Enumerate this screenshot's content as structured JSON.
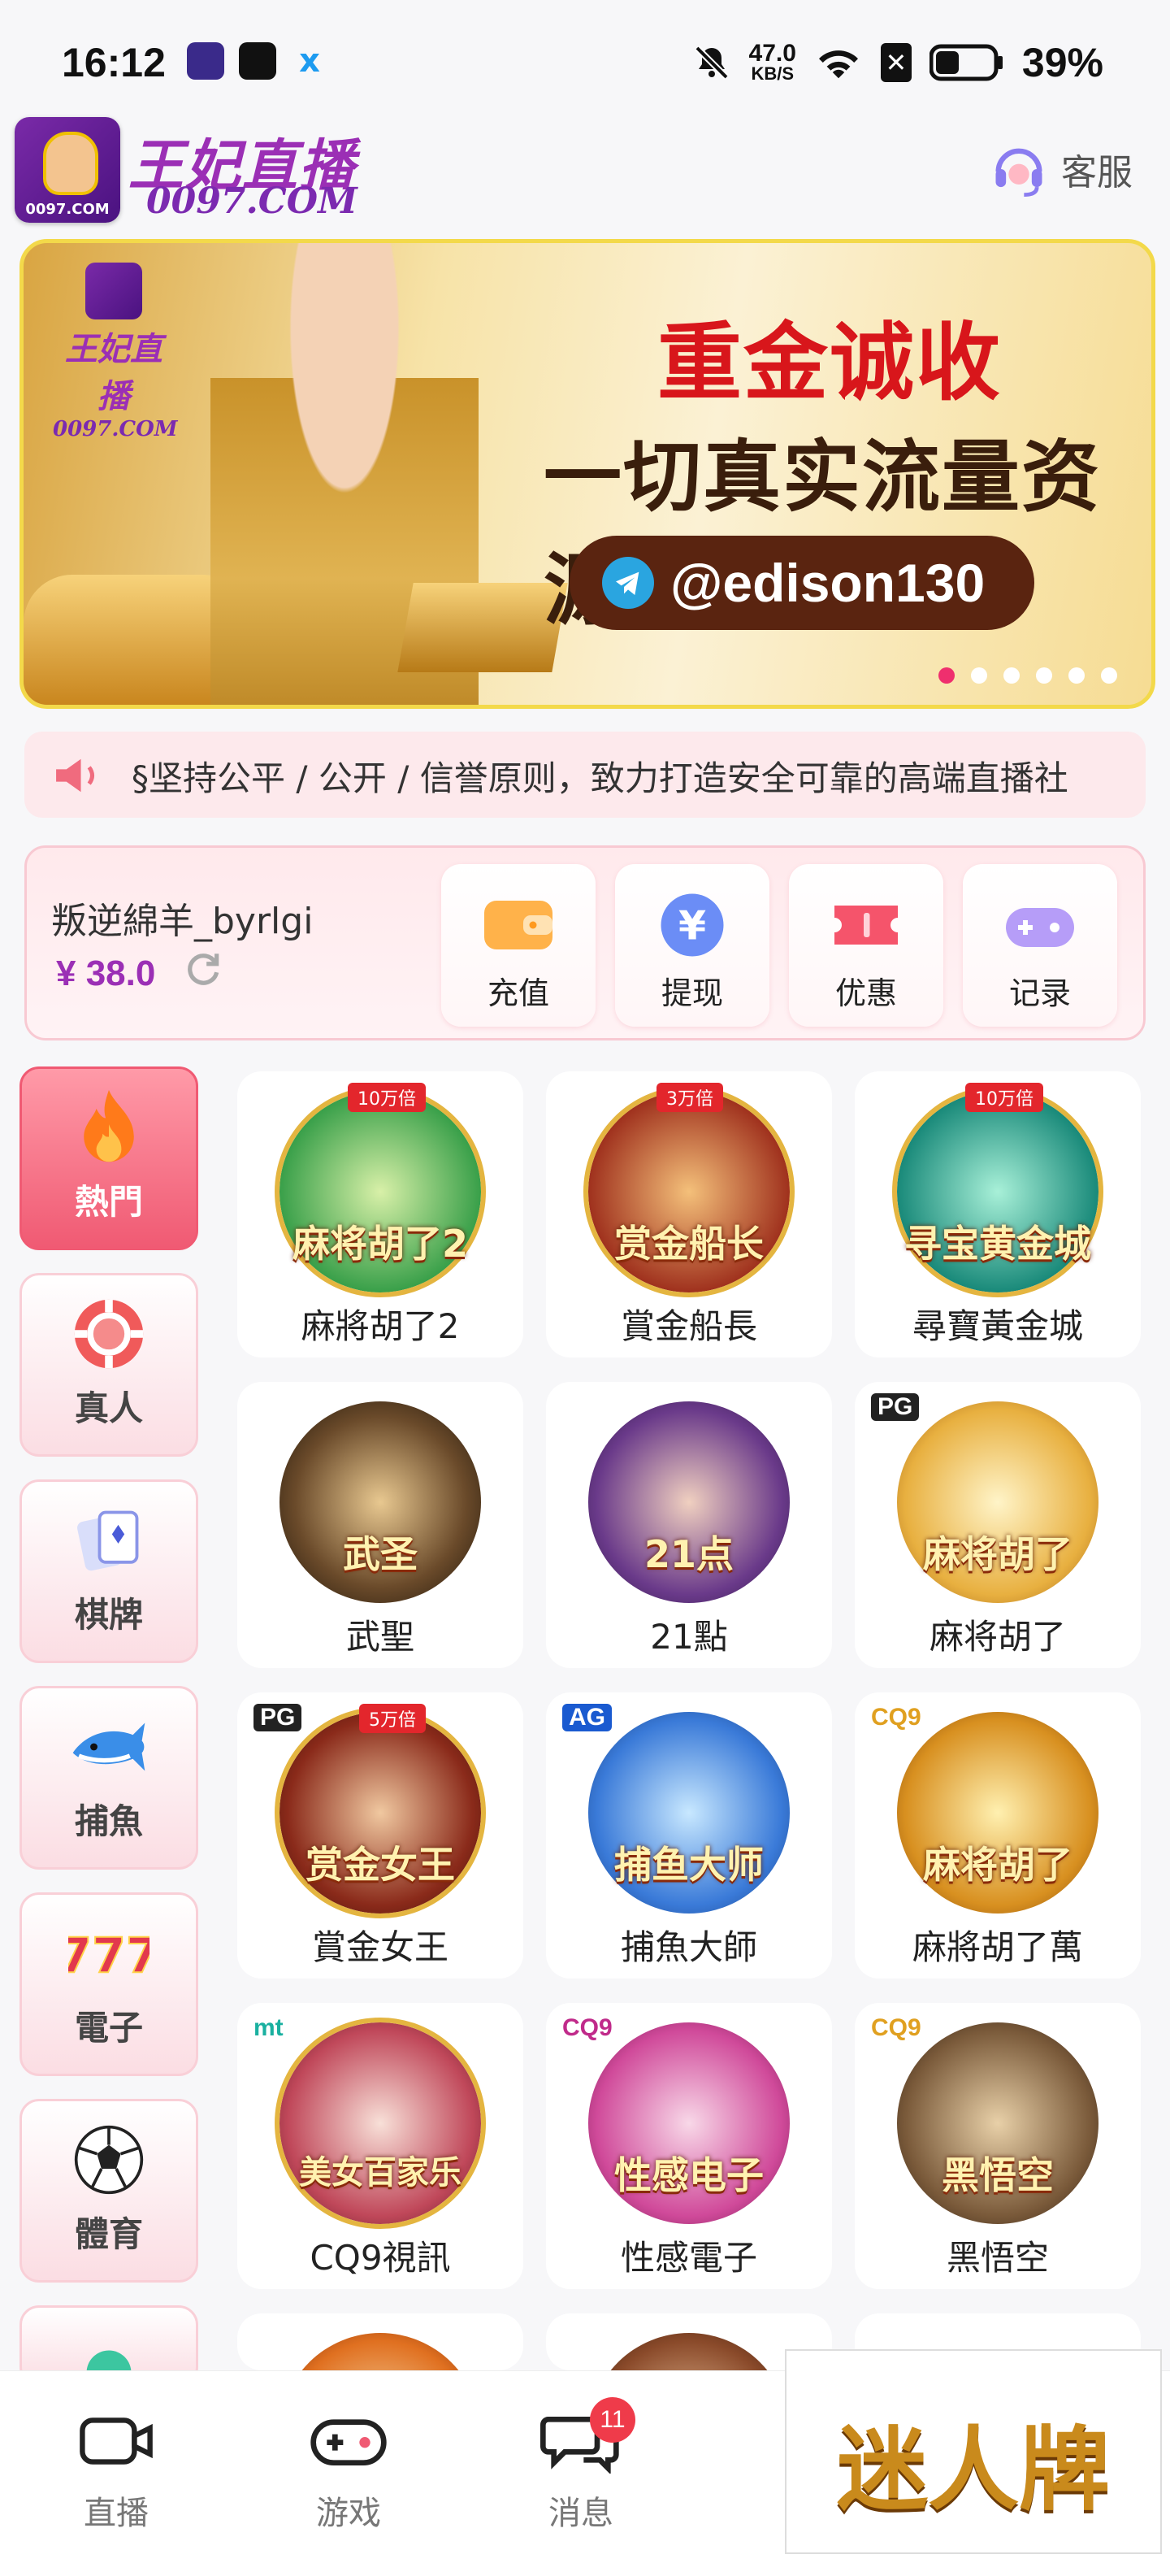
{
  "status_bar": {
    "time": "16:12",
    "speed_value": "47.0",
    "speed_unit": "KB/S",
    "battery": "39%"
  },
  "header": {
    "brand_name": "王妃直播",
    "brand_url": "0097.COM",
    "service_label": "客服"
  },
  "banner": {
    "headline": "重金诚收",
    "subheadline": "一切真实流量资源",
    "telegram_handle": "@edison130",
    "mini_logo_name": "王妃直播",
    "mini_logo_url": "0097.COM",
    "slide_count": 6,
    "active_slide": 1
  },
  "marquee": {
    "text": "§坚持公平 / 公开 / 信誉原则，致力打造安全可靠的高端直播社"
  },
  "account": {
    "username": "叛逆綿羊_byrlgi",
    "balance": "¥ 38.0",
    "actions": [
      {
        "label": "充值",
        "icon": "wallet-icon"
      },
      {
        "label": "提现",
        "icon": "yen-coin-icon"
      },
      {
        "label": "优惠",
        "icon": "ticket-icon"
      },
      {
        "label": "记录",
        "icon": "gamepad-icon"
      }
    ]
  },
  "categories": [
    {
      "label": "熱門",
      "icon": "flame-icon",
      "active": true
    },
    {
      "label": "真人",
      "icon": "poker-chip-icon"
    },
    {
      "label": "棋牌",
      "icon": "playing-cards-icon"
    },
    {
      "label": "捕魚",
      "icon": "shark-icon"
    },
    {
      "label": "電子",
      "icon": "slot-777-icon"
    },
    {
      "label": "體育",
      "icon": "soccer-ball-icon"
    }
  ],
  "games": [
    {
      "name": "麻將胡了2",
      "mult": "10万倍",
      "art": "麻将胡了2"
    },
    {
      "name": "賞金船長",
      "mult": "3万倍",
      "art": "赏金船长"
    },
    {
      "name": "尋寶黃金城",
      "mult": "10万倍",
      "art": "寻宝黄金城"
    },
    {
      "name": "武聖",
      "art": "武圣"
    },
    {
      "name": "21點",
      "art": "21点"
    },
    {
      "name": "麻将胡了",
      "brand": "PG",
      "art": "麻将胡了"
    },
    {
      "name": "賞金女王",
      "brand": "PG",
      "mult": "5万倍",
      "art": "赏金女王"
    },
    {
      "name": "捕魚大師",
      "brand": "AG",
      "art": "捕鱼大师"
    },
    {
      "name": "麻將胡了萬",
      "brand": "CQ9",
      "art": "麻将胡了"
    },
    {
      "name": "CQ9視訊",
      "brand": "mt",
      "art": "美女百家乐"
    },
    {
      "name": "性感電子",
      "brand": "CQ9",
      "art": "性感电子"
    },
    {
      "name": "黑悟空",
      "brand": "CQ9",
      "art": "黑悟空"
    }
  ],
  "bottom_nav": [
    {
      "label": "直播",
      "icon": "camera-icon"
    },
    {
      "label": "游戏",
      "icon": "gamepad-icon"
    },
    {
      "label": "消息",
      "icon": "chat-icon",
      "badge": "11"
    }
  ],
  "promo_overlay": {
    "text": "迷人牌"
  }
}
